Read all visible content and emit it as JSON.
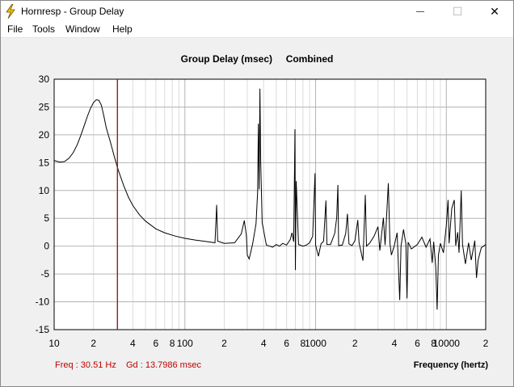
{
  "window": {
    "title": "Hornresp - Group Delay",
    "controls": {
      "minimize": "—",
      "maximize": "☐",
      "close": "✕"
    }
  },
  "menu": {
    "items": [
      "File",
      "Tools",
      "Window",
      "Help"
    ]
  },
  "chart_data": {
    "type": "line",
    "title": "Group Delay (msec)",
    "subtitle": "Combined",
    "xlabel": "Frequency (hertz)",
    "ylabel": "",
    "xscale": "log",
    "xlim": [
      10,
      20000
    ],
    "ylim": [
      -15,
      30
    ],
    "yticks": [
      30,
      25,
      20,
      15,
      10,
      5,
      0,
      -5,
      -10,
      -15
    ],
    "xtick_labels": [
      {
        "value": 10,
        "label": "10"
      },
      {
        "value": 20,
        "label": "2"
      },
      {
        "value": 40,
        "label": "4"
      },
      {
        "value": 60,
        "label": "6"
      },
      {
        "value": 80,
        "label": "8"
      },
      {
        "value": 100,
        "label": "100"
      },
      {
        "value": 200,
        "label": "2"
      },
      {
        "value": 400,
        "label": "4"
      },
      {
        "value": 600,
        "label": "6"
      },
      {
        "value": 800,
        "label": "8"
      },
      {
        "value": 1000,
        "label": "1000"
      },
      {
        "value": 2000,
        "label": "2"
      },
      {
        "value": 4000,
        "label": "4"
      },
      {
        "value": 6000,
        "label": "6"
      },
      {
        "value": 8000,
        "label": "8"
      },
      {
        "value": 10000,
        "label": "10000"
      },
      {
        "value": 20000,
        "label": "2"
      }
    ],
    "grid": true,
    "series": [
      {
        "color": "#000000",
        "points": [
          [
            10,
            15.4
          ],
          [
            11,
            15.1
          ],
          [
            12,
            15.2
          ],
          [
            13,
            15.8
          ],
          [
            14,
            16.8
          ],
          [
            15,
            18.2
          ],
          [
            16,
            19.9
          ],
          [
            17,
            21.7
          ],
          [
            18,
            23.4
          ],
          [
            19,
            24.8
          ],
          [
            20,
            25.8
          ],
          [
            21,
            26.3
          ],
          [
            22,
            26.2
          ],
          [
            23,
            25.3
          ],
          [
            24,
            23.4
          ],
          [
            25,
            21.3
          ],
          [
            27,
            18.6
          ],
          [
            29,
            15.9
          ],
          [
            31,
            13.6
          ],
          [
            34,
            10.9
          ],
          [
            37,
            8.8
          ],
          [
            40,
            7.3
          ],
          [
            45,
            5.6
          ],
          [
            50,
            4.5
          ],
          [
            60,
            3.1
          ],
          [
            70,
            2.4
          ],
          [
            85,
            1.8
          ],
          [
            100,
            1.4
          ],
          [
            120,
            1.1
          ],
          [
            150,
            0.8
          ],
          [
            170,
            0.6
          ],
          [
            175,
            7.4
          ],
          [
            178,
            0.9
          ],
          [
            200,
            0.5
          ],
          [
            240,
            0.6
          ],
          [
            270,
            2.2
          ],
          [
            285,
            4.6
          ],
          [
            295,
            2.0
          ],
          [
            300,
            -1.6
          ],
          [
            310,
            -2.3
          ],
          [
            330,
            0.4
          ],
          [
            350,
            4.0
          ],
          [
            360,
            9.8
          ],
          [
            365,
            22.0
          ],
          [
            370,
            10.2
          ],
          [
            375,
            28.3
          ],
          [
            380,
            15.0
          ],
          [
            390,
            4.2
          ],
          [
            420,
            0.2
          ],
          [
            470,
            -0.2
          ],
          [
            500,
            0.3
          ],
          [
            530,
            0.0
          ],
          [
            560,
            0.5
          ],
          [
            600,
            0.2
          ],
          [
            640,
            1.2
          ],
          [
            660,
            2.4
          ],
          [
            680,
            0.8
          ],
          [
            695,
            21.0
          ],
          [
            700,
            -4.3
          ],
          [
            710,
            11.7
          ],
          [
            740,
            0.3
          ],
          [
            800,
            0.0
          ],
          [
            850,
            0.2
          ],
          [
            900,
            0.6
          ],
          [
            950,
            1.8
          ],
          [
            990,
            13.1
          ],
          [
            1000,
            0.2
          ],
          [
            1050,
            -1.8
          ],
          [
            1100,
            0.4
          ],
          [
            1150,
            0.9
          ],
          [
            1200,
            8.2
          ],
          [
            1220,
            0.3
          ],
          [
            1300,
            0.3
          ],
          [
            1400,
            2.3
          ],
          [
            1450,
            5.1
          ],
          [
            1480,
            11.0
          ],
          [
            1500,
            0.1
          ],
          [
            1600,
            0.2
          ],
          [
            1700,
            2.3
          ],
          [
            1750,
            5.8
          ],
          [
            1800,
            0.4
          ],
          [
            1900,
            0.1
          ],
          [
            2000,
            1.0
          ],
          [
            2100,
            4.7
          ],
          [
            2150,
            0.6
          ],
          [
            2300,
            -2.6
          ],
          [
            2400,
            9.2
          ],
          [
            2450,
            0.0
          ],
          [
            2600,
            0.6
          ],
          [
            2800,
            1.8
          ],
          [
            3000,
            3.5
          ],
          [
            3100,
            -0.8
          ],
          [
            3300,
            5.1
          ],
          [
            3400,
            0.2
          ],
          [
            3600,
            11.3
          ],
          [
            3700,
            0.5
          ],
          [
            3800,
            -1.6
          ],
          [
            4000,
            0.1
          ],
          [
            4200,
            2.4
          ],
          [
            4400,
            -9.7
          ],
          [
            4500,
            0.0
          ],
          [
            4700,
            3.0
          ],
          [
            4900,
            0.4
          ],
          [
            5000,
            -9.4
          ],
          [
            5100,
            0.7
          ],
          [
            5400,
            -0.5
          ],
          [
            6000,
            0.3
          ],
          [
            6500,
            1.6
          ],
          [
            7000,
            -0.2
          ],
          [
            7500,
            1.3
          ],
          [
            7800,
            -3.0
          ],
          [
            8000,
            0.8
          ],
          [
            8300,
            -3.8
          ],
          [
            8500,
            -11.4
          ],
          [
            8700,
            -1.6
          ],
          [
            9000,
            0.5
          ],
          [
            9500,
            -1.2
          ],
          [
            10000,
            3.8
          ],
          [
            10300,
            8.3
          ],
          [
            10500,
            0.5
          ],
          [
            11000,
            6.8
          ],
          [
            11500,
            8.3
          ],
          [
            11800,
            0.1
          ],
          [
            12200,
            2.5
          ],
          [
            12500,
            -1.2
          ],
          [
            13000,
            10.0
          ],
          [
            13300,
            0.3
          ],
          [
            14000,
            -3.2
          ],
          [
            14800,
            0.6
          ],
          [
            15500,
            -2.5
          ],
          [
            16500,
            1.0
          ],
          [
            17000,
            -5.7
          ],
          [
            17500,
            -2.5
          ],
          [
            18500,
            -0.3
          ],
          [
            20000,
            0.3
          ]
        ]
      }
    ],
    "cursor": {
      "frequency": 30.51,
      "color": "#c00000"
    }
  },
  "readouts": {
    "frequency": "Freq : 30.51 Hz",
    "group_delay": "Gd : 13.7986 msec"
  },
  "colors": {
    "background": "#f0f0f0",
    "plot_background": "#ffffff",
    "grid_major": "#b4b4b4",
    "grid_minor": "#dcdcdc",
    "trace": "#000000",
    "cursor": "#c00000",
    "title_icon": "#e8b400"
  }
}
